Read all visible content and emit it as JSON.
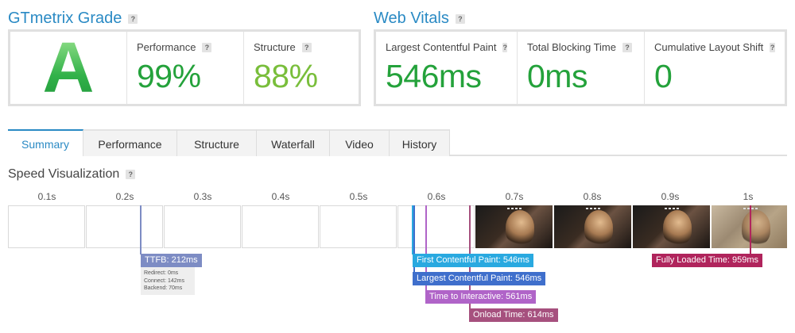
{
  "grade": {
    "title": "GTmetrix Grade",
    "letter": "A",
    "performance_label": "Performance",
    "performance_value": "99%",
    "structure_label": "Structure",
    "structure_value": "88%"
  },
  "vitals": {
    "title": "Web Vitals",
    "lcp_label": "Largest Contentful Paint",
    "lcp_value": "546ms",
    "tbt_label": "Total Blocking Time",
    "tbt_value": "0ms",
    "cls_label": "Cumulative Layout Shift",
    "cls_value": "0"
  },
  "help_glyph": "?",
  "tabs": [
    {
      "label": "Summary",
      "active": true
    },
    {
      "label": "Performance",
      "active": false
    },
    {
      "label": "Structure",
      "active": false
    },
    {
      "label": "Waterfall",
      "active": false
    },
    {
      "label": "Video",
      "active": false
    },
    {
      "label": "History",
      "active": false
    }
  ],
  "speed": {
    "title": "Speed Visualization",
    "ticks": [
      "0.1s",
      "0.2s",
      "0.3s",
      "0.4s",
      "0.5s",
      "0.6s",
      "0.7s",
      "0.8s",
      "0.9s",
      "1s"
    ],
    "ttfb_label": "TTFB: 212ms",
    "ttfb_redirect": "Redirect: 0ms",
    "ttfb_connect": "Connect: 142ms",
    "ttfb_backend": "Backend: 70ms",
    "fcp_label": "First Contentful Paint: 546ms",
    "lcp_label": "Largest Contentful Paint: 546ms",
    "tti_label": "Time to Interactive: 561ms",
    "onload_label": "Onload Time: 614ms",
    "fully_loaded_label": "Fully Loaded Time: 959ms",
    "colors": {
      "ttfb": "#7d8cc4",
      "fcp": "#29a9e0",
      "lcp": "#3f6fcc",
      "tti": "#b064c8",
      "onload": "#a6507e",
      "fully_loaded": "#b0245c"
    }
  }
}
